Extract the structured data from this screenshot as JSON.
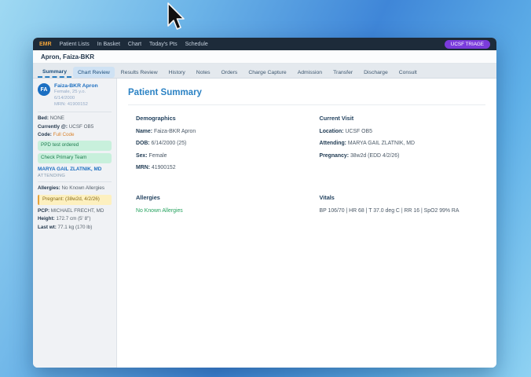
{
  "window": {
    "topnav": {
      "brand": "EMR",
      "items": [
        "Patient Lists",
        "In Basket",
        "Chart",
        "Today's Pts",
        "Schedule"
      ],
      "badge": "UCSF TRIAGE"
    },
    "patient_header": "Apron, Faiza-BKR",
    "tabs": [
      "Summary",
      "Chart Review",
      "Results Review",
      "History",
      "Notes",
      "Orders",
      "Charge Capture",
      "Admission",
      "Transfer",
      "Discharge",
      "Consult"
    ],
    "active_tab": "Summary"
  },
  "sidebar": {
    "avatar_initials": "FA",
    "patient_name": "Faiza-BKR Apron",
    "demo_line1": "Female, 25 y.o.",
    "demo_line2": "6/14/2000",
    "demo_line3": "MRN: 41900152",
    "bed_label": "Bed:",
    "bed_value": "NONE",
    "currently_label": "Currently @:",
    "currently_value": "UCSF OB5",
    "code_label": "Code:",
    "code_value": "Full Code",
    "alerts": [
      "PPD test ordered",
      "Check Primary Team"
    ],
    "attending_name": "MARYA GAIL ZLATNIK, MD",
    "attending_role": "ATTENDING",
    "allergies_label": "Allergies:",
    "allergies_value": "No Known Allergies",
    "pregnancy_banner": "Pregnant: (38w2d, 4/2/26)",
    "pcp_label": "PCP:",
    "pcp_value": "MICHAEL FRECHT, MD",
    "height_label": "Height:",
    "height_value": "172.7 cm (5' 8\")",
    "wt_label": "Last wt:",
    "wt_value": "77.1 kg (170 lb)"
  },
  "main": {
    "title": "Patient Summary",
    "sections": {
      "demographics": {
        "heading": "Demographics",
        "rows": [
          [
            "Name:",
            "Faiza-BKR Apron"
          ],
          [
            "DOB:",
            "6/14/2000 (25)"
          ],
          [
            "Sex:",
            "Female"
          ],
          [
            "MRN:",
            "41900152"
          ]
        ]
      },
      "current_visit": {
        "heading": "Current Visit",
        "rows": [
          [
            "Location:",
            "UCSF OB5"
          ],
          [
            "Attending:",
            "MARYA GAIL ZLATNIK, MD"
          ],
          [
            "Pregnancy:",
            "38w2d (EDD 4/2/26)"
          ]
        ]
      },
      "allergies": {
        "heading": "Allergies",
        "value": "No Known Allergies"
      },
      "vitals": {
        "heading": "Vitals",
        "value": "BP 106/70 | HR 68 | T 37.0 deg C | RR 16 | SpO2 99% RA"
      }
    }
  }
}
